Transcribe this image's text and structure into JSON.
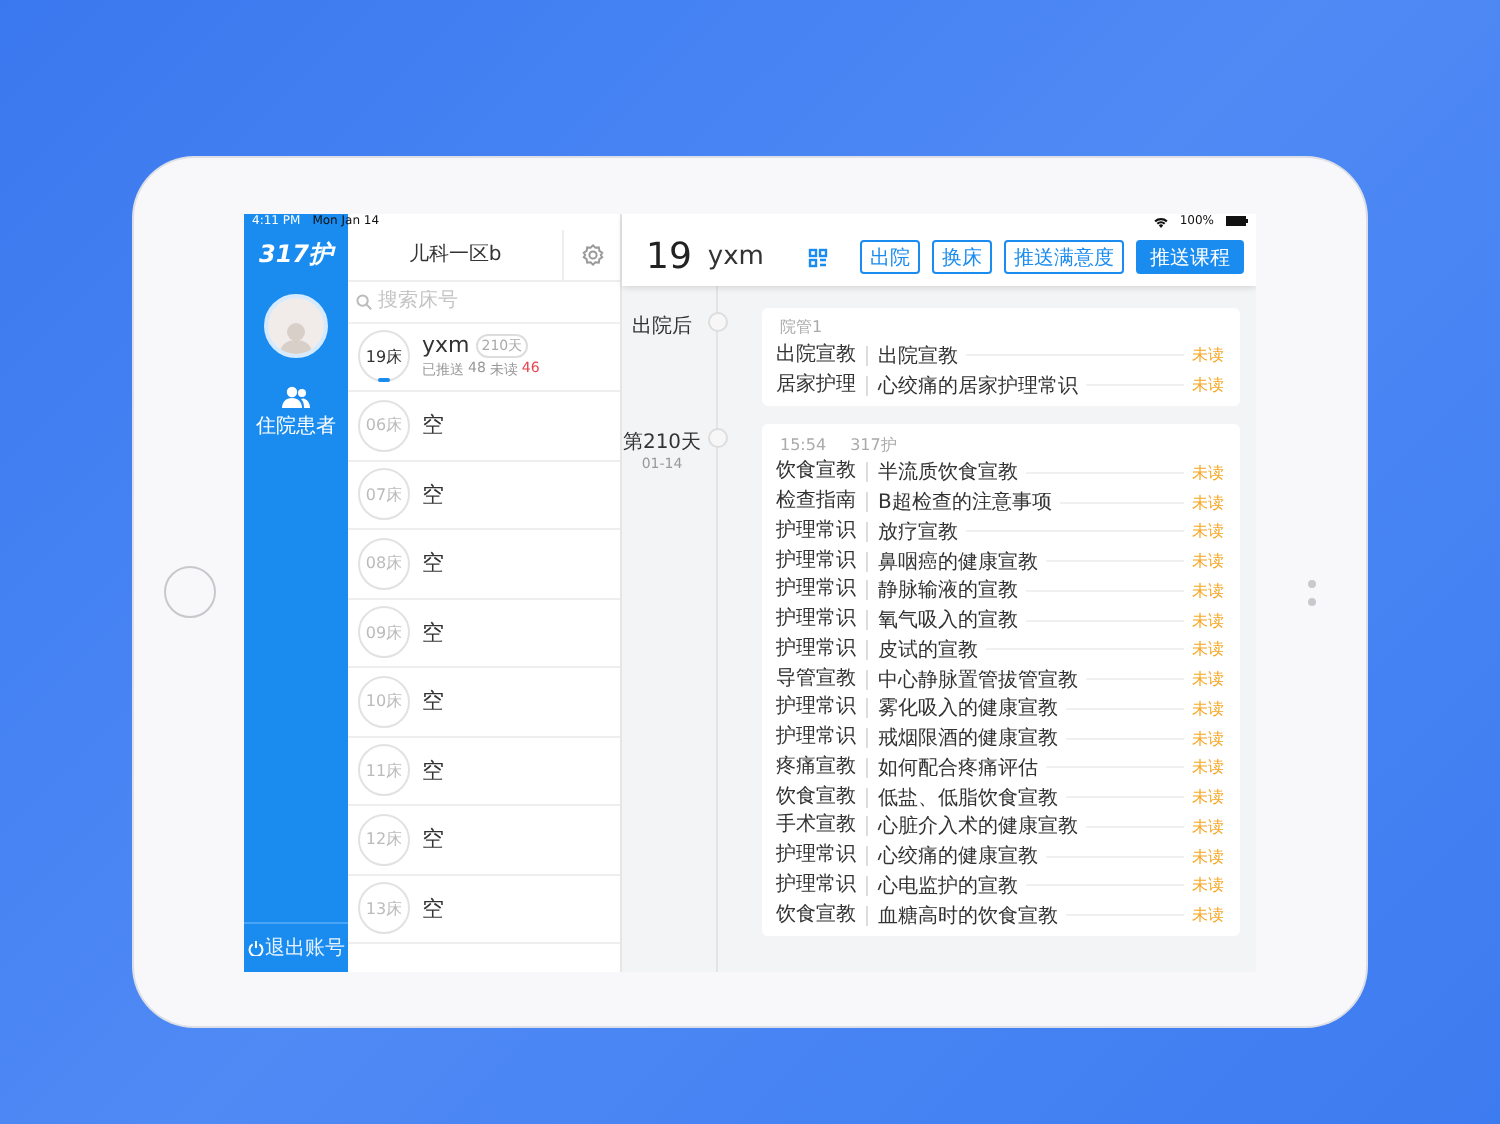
{
  "status_bar": {
    "time": "4:11 PM",
    "date": "Mon Jan 14",
    "battery": "100%"
  },
  "nav": {
    "logo": "317护",
    "items": [
      {
        "label": "住院患者",
        "selected": true
      }
    ],
    "logout": "退出账号"
  },
  "ward": {
    "title": "儿科一区b",
    "search": {
      "placeholder": "搜索床号"
    },
    "beds": [
      {
        "kind": "occupied",
        "bed": "19床",
        "name": "yxm",
        "days": "210天",
        "pushed_label": "已推送",
        "pushed": "48",
        "unread_label": "未读",
        "unread": "46"
      },
      {
        "kind": "empty",
        "bed": "06床",
        "name": "空"
      },
      {
        "kind": "empty",
        "bed": "07床",
        "name": "空"
      },
      {
        "kind": "empty",
        "bed": "08床",
        "name": "空"
      },
      {
        "kind": "empty",
        "bed": "09床",
        "name": "空"
      },
      {
        "kind": "empty",
        "bed": "10床",
        "name": "空"
      },
      {
        "kind": "empty",
        "bed": "11床",
        "name": "空"
      },
      {
        "kind": "empty",
        "bed": "12床",
        "name": "空"
      },
      {
        "kind": "empty",
        "bed": "13床",
        "name": "空"
      }
    ]
  },
  "main": {
    "bed_number": "19",
    "patient_name": "yxm",
    "buttons": [
      {
        "label": "出院",
        "kind": "outline"
      },
      {
        "label": "换床",
        "kind": "outline"
      },
      {
        "label": "推送满意度",
        "kind": "outline"
      },
      {
        "label": "推送课程",
        "kind": "primary"
      }
    ],
    "timeline": [
      {
        "label": "出院后",
        "sender": "院管1",
        "items": [
          {
            "category": "出院宣教",
            "title": "出院宣教",
            "status": "未读"
          },
          {
            "category": "居家护理",
            "title": "心绞痛的居家护理常识",
            "status": "未读"
          }
        ]
      },
      {
        "label": "第210天",
        "date": "01-14",
        "time": "15:54",
        "sender": "317护",
        "items": [
          {
            "category": "饮食宣教",
            "title": "半流质饮食宣教",
            "status": "未读"
          },
          {
            "category": "检查指南",
            "title": "B超检查的注意事项",
            "status": "未读"
          },
          {
            "category": "护理常识",
            "title": "放疗宣教",
            "status": "未读"
          },
          {
            "category": "护理常识",
            "title": "鼻咽癌的健康宣教",
            "status": "未读"
          },
          {
            "category": "护理常识",
            "title": "静脉输液的宣教",
            "status": "未读"
          },
          {
            "category": "护理常识",
            "title": "氧气吸入的宣教",
            "status": "未读"
          },
          {
            "category": "护理常识",
            "title": "皮试的宣教",
            "status": "未读"
          },
          {
            "category": "导管宣教",
            "title": "中心静脉置管拔管宣教",
            "status": "未读"
          },
          {
            "category": "护理常识",
            "title": "雾化吸入的健康宣教",
            "status": "未读"
          },
          {
            "category": "护理常识",
            "title": "戒烟限酒的健康宣教",
            "status": "未读"
          },
          {
            "category": "疼痛宣教",
            "title": "如何配合疼痛评估",
            "status": "未读"
          },
          {
            "category": "饮食宣教",
            "title": "低盐、低脂饮食宣教",
            "status": "未读"
          },
          {
            "category": "手术宣教",
            "title": "心脏介入术的健康宣教",
            "status": "未读"
          },
          {
            "category": "护理常识",
            "title": "心绞痛的健康宣教",
            "status": "未读"
          },
          {
            "category": "护理常识",
            "title": "心电监护的宣教",
            "status": "未读"
          },
          {
            "category": "饮食宣教",
            "title": "血糖高时的饮食宣教",
            "status": "未读"
          }
        ]
      }
    ]
  }
}
